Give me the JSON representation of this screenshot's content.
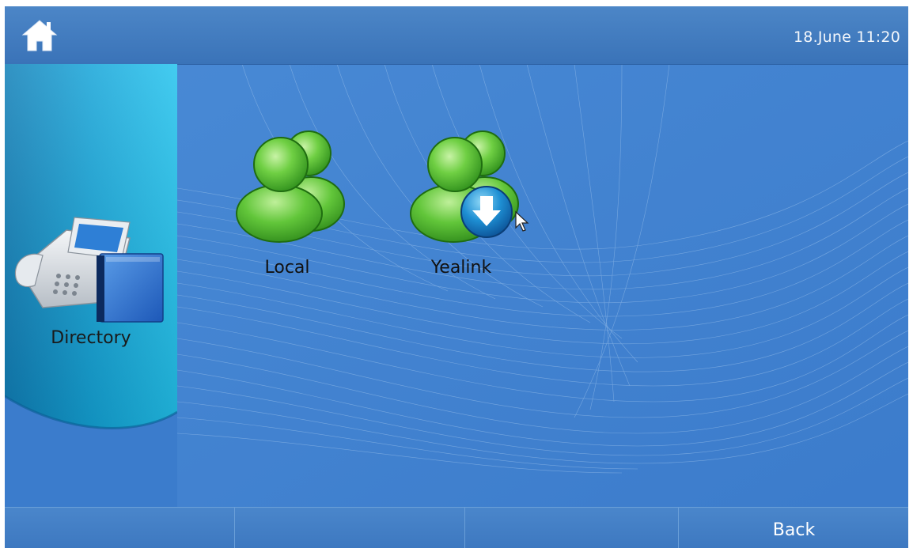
{
  "header": {
    "home_icon": "home-icon",
    "datetime": "18.June 11:20"
  },
  "sidebar": {
    "title": "Directory",
    "icon": "directory-phone-book-icon"
  },
  "main": {
    "items": [
      {
        "label": "Local",
        "icon": "contacts-group-icon"
      },
      {
        "label": "Yealink",
        "icon": "remote-contacts-download-icon"
      }
    ]
  },
  "softkeys": [
    {
      "label": ""
    },
    {
      "label": ""
    },
    {
      "label": ""
    },
    {
      "label": "Back"
    }
  ],
  "colors": {
    "background": "#3f7fce",
    "sidebar_accent": "#1ab0e0",
    "icon_green": "#5cc43c",
    "text_light": "#ffffff"
  }
}
